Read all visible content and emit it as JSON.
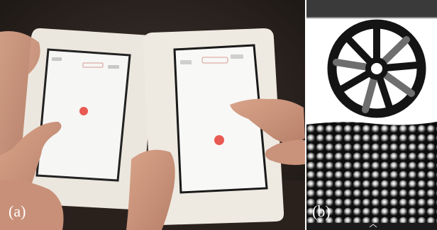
{
  "panels": [
    {
      "label": "(a)",
      "content": "photo-two-tablets-with-hands"
    },
    {
      "label": "(b)",
      "content": "wheel-drawing-over-bump-texture"
    }
  ],
  "colors": {
    "dot": "#e85a52",
    "tablet_frame": "#eeeae2",
    "screen": "#f7f7f5",
    "spoke_dark": "#141414",
    "spoke_grey": "#6e6e6e",
    "background_dark": "#2b2522"
  }
}
